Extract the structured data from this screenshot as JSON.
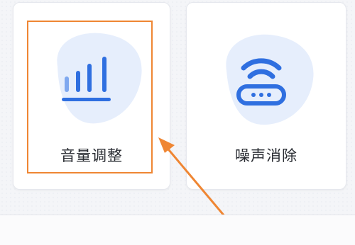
{
  "cards": [
    {
      "label": "音量调整",
      "icon": "volume-bars-icon"
    },
    {
      "label": "噪声消除",
      "icon": "noise-cancel-router-icon"
    }
  ],
  "colors": {
    "icon_blue": "#2f6fe0",
    "icon_blue_light": "#7fa8ef",
    "blob_bg": "#e6eefc",
    "highlight_orange": "#ef8633"
  }
}
